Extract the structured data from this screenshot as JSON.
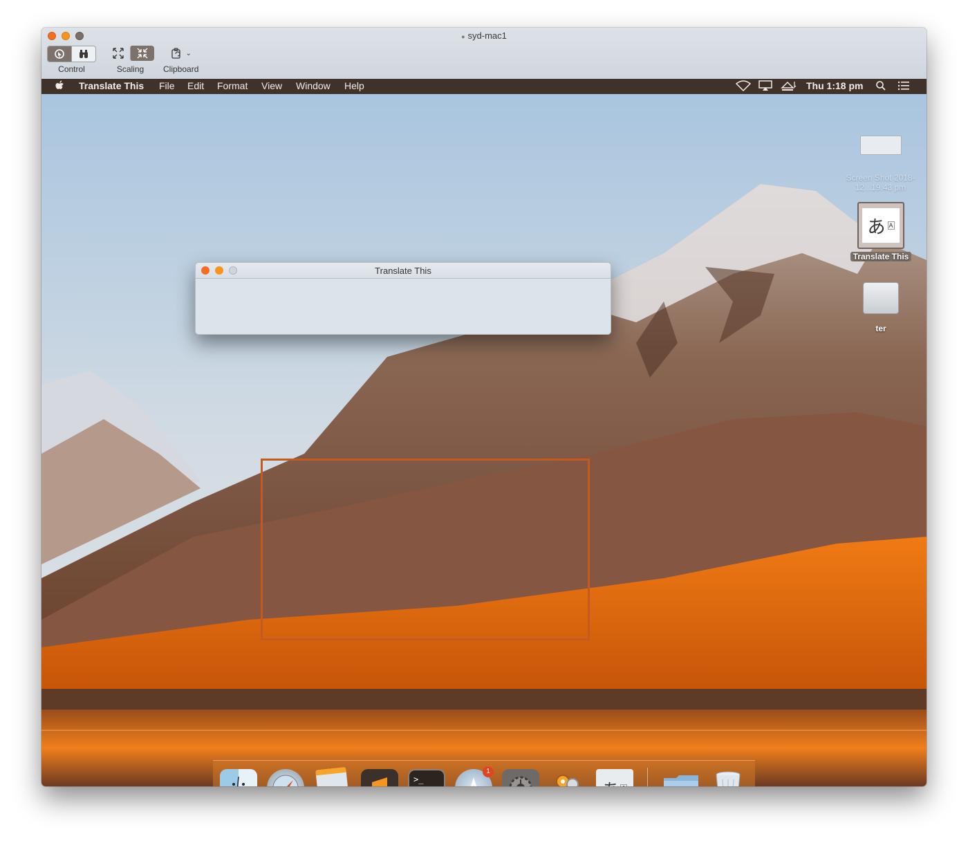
{
  "outer_window": {
    "title": "syd-mac1",
    "toolbar": {
      "control_label": "Control",
      "scaling_label": "Scaling",
      "clipboard_label": "Clipboard"
    }
  },
  "menubar": {
    "app_name": "Translate This",
    "items": [
      "File",
      "Edit",
      "Format",
      "View",
      "Window",
      "Help"
    ],
    "clock": "Thu 1:18 pm"
  },
  "translate_window": {
    "title": "Translate This"
  },
  "desktop_icons": {
    "screenshot": "Screen Shot 2018-12...19.43 pm",
    "app": "Translate This",
    "drive": "ter"
  },
  "dock": {
    "items": [
      {
        "name": "finder",
        "icon": "finder-icon",
        "running": true
      },
      {
        "name": "safari",
        "icon": "compass-icon",
        "running": false
      },
      {
        "name": "notes",
        "icon": "notes-icon",
        "running": false
      },
      {
        "name": "sublime-text",
        "icon": "sublime-icon",
        "running": true
      },
      {
        "name": "terminal",
        "icon": "terminal-icon",
        "running": true
      },
      {
        "name": "app-store",
        "icon": "app-store-icon",
        "running": false,
        "badge": "1"
      },
      {
        "name": "system-preferences",
        "icon": "gear-icon",
        "running": false
      },
      {
        "name": "keychain",
        "icon": "keys-icon",
        "running": true
      },
      {
        "name": "translate-this",
        "icon": "translate-icon",
        "running": true
      },
      {
        "name": "downloads",
        "icon": "folder-icon",
        "running": false
      },
      {
        "name": "trash",
        "icon": "trash-icon",
        "running": false
      }
    ],
    "terminal_prompt": ">_",
    "translate_glyph": "あ",
    "translate_small": "A"
  },
  "colors": {
    "menubar_bg": "#3f322a",
    "accent_orange": "#f26f21",
    "selection_border": "#c45a20"
  }
}
